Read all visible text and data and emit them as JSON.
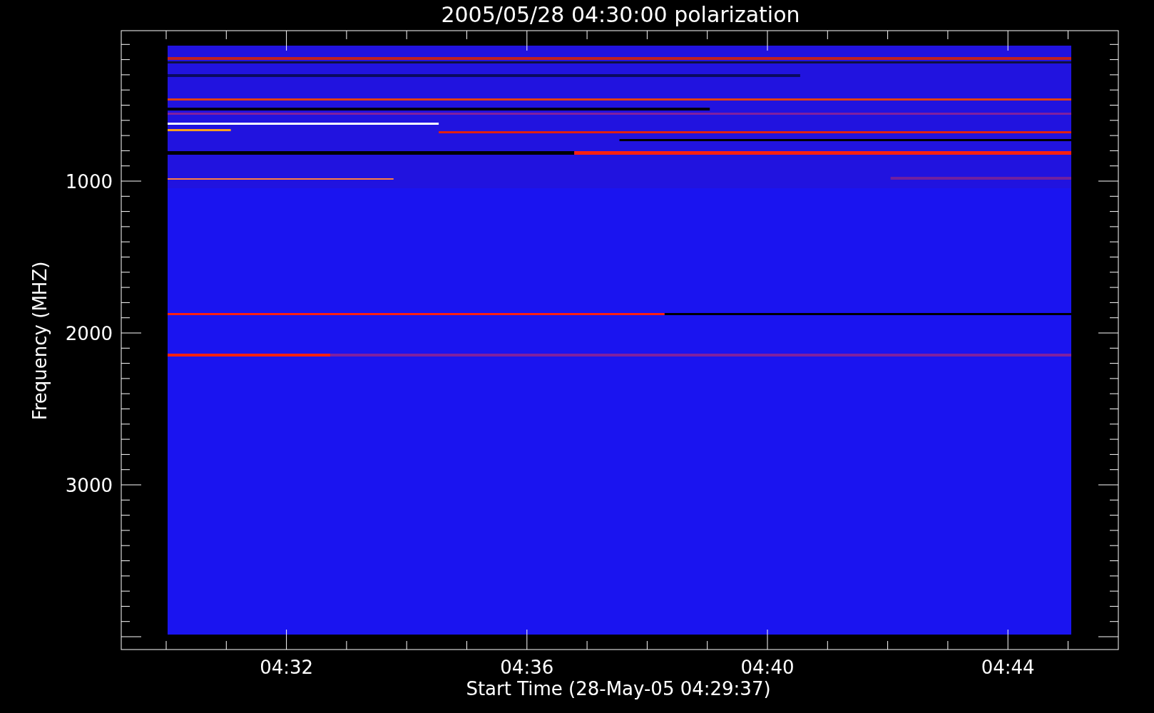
{
  "title": "2005/05/28 04:30:00 polarization",
  "ylabel": "Frequency (MHZ)",
  "xlabel": "Start Time (28-May-05 04:29:37)",
  "y_tick_labels": [
    "1000",
    "2000",
    "3000"
  ],
  "x_tick_labels": [
    "04:32",
    "04:36",
    "04:40",
    "04:44"
  ]
}
